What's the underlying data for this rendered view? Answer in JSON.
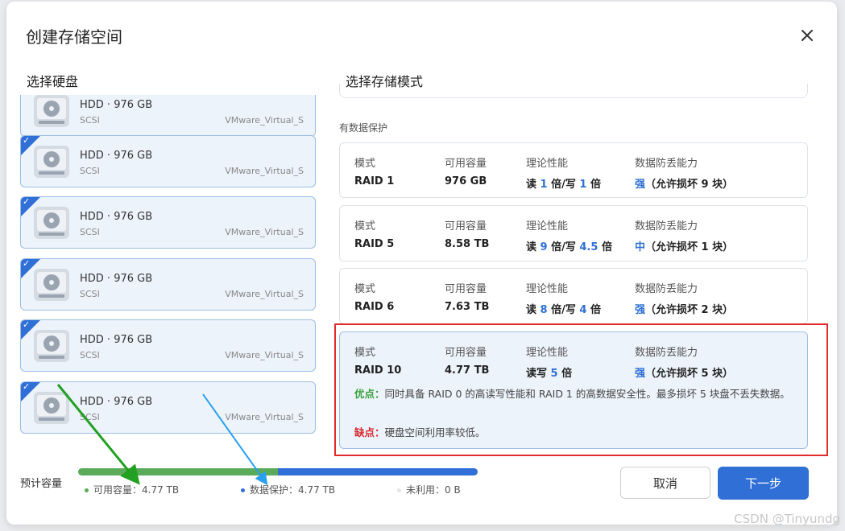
{
  "dialog": {
    "title": "创建存储空间"
  },
  "disks_section": {
    "title": "选择硬盘"
  },
  "disks": [
    {
      "name": "HDD · 976 GB",
      "bus": "SCSI",
      "model": "VMware_Virtual_S",
      "checked": false
    },
    {
      "name": "HDD · 976 GB",
      "bus": "SCSI",
      "model": "VMware_Virtual_S",
      "checked": true
    },
    {
      "name": "HDD · 976 GB",
      "bus": "SCSI",
      "model": "VMware_Virtual_S",
      "checked": true
    },
    {
      "name": "HDD · 976 GB",
      "bus": "SCSI",
      "model": "VMware_Virtual_S",
      "checked": true
    },
    {
      "name": "HDD · 976 GB",
      "bus": "SCSI",
      "model": "VMware_Virtual_S",
      "checked": true
    },
    {
      "name": "HDD · 976 GB",
      "bus": "SCSI",
      "model": "VMware_Virtual_S",
      "checked": true
    }
  ],
  "modes_section": {
    "title": "选择存储模式",
    "group_label": "有数据保护"
  },
  "mode_headers": {
    "mode": "模式",
    "capacity": "可用容量",
    "performance": "理论性能",
    "protection": "数据防丢能力"
  },
  "modes": [
    {
      "name": "RAID 1",
      "capacity": "976 GB",
      "perf": [
        "读 ",
        "1",
        " 倍/写 ",
        "1",
        " 倍"
      ],
      "level": "强",
      "level_note": "（允许损坏 9 块）"
    },
    {
      "name": "RAID 5",
      "capacity": "8.58 TB",
      "perf": [
        "读 ",
        "9",
        " 倍/写 ",
        "4.5",
        " 倍"
      ],
      "level": "中",
      "level_note": "（允许损坏 1 块）"
    },
    {
      "name": "RAID 6",
      "capacity": "7.63 TB",
      "perf": [
        "读 ",
        "8",
        " 倍/写 ",
        "4",
        " 倍"
      ],
      "level": "强",
      "level_note": "（允许损坏 2 块）"
    },
    {
      "name": "RAID 10",
      "capacity": "4.77 TB",
      "perf": [
        "读写 ",
        "5",
        " 倍",
        "",
        ""
      ],
      "level": "强",
      "level_note": "（允许损坏 5 块）",
      "pros_label": "优点：",
      "pros": "同时具备 RAID 0 的高读写性能和 RAID 1 的高数据安全性。最多损坏 5 块盘不丢失数据。",
      "cons_label": "缺点：",
      "cons": "硬盘空间利用率较低。"
    }
  ],
  "capacity": {
    "label": "预计容量",
    "used_fraction": 0.5,
    "protected_fraction": 0.5,
    "legend": [
      {
        "label": "可用容量：",
        "value": "4.77 TB",
        "color": "#5aaa5a"
      },
      {
        "label": "数据保护：",
        "value": "4.77 TB",
        "color": "#2f6fd6"
      },
      {
        "label": "未利用：",
        "value": "0 B",
        "color": "#e6e6e6"
      }
    ]
  },
  "buttons": {
    "cancel": "取消",
    "next": "下一步"
  },
  "watermark": "CSDN @Tinyundg",
  "colors": {
    "accent": "#2f6fd6",
    "highlight": "#e22a2a",
    "pros": "#3aa03a",
    "cons": "#d9282f"
  }
}
